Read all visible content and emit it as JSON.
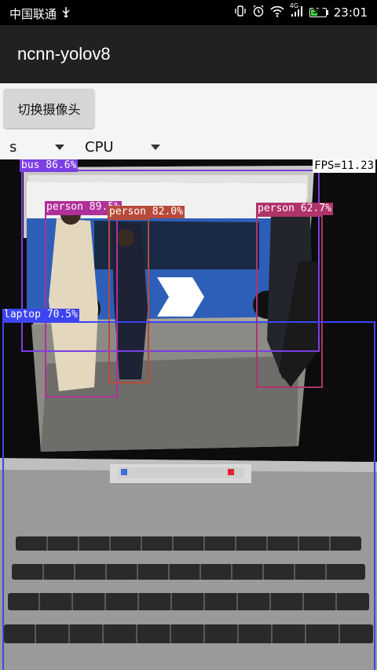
{
  "status_bar": {
    "carrier": "中国联通",
    "usb_icon": "usb-icon",
    "network_badge": "4G",
    "battery_level": "35",
    "time": "23:01"
  },
  "app_bar": {
    "title": "ncnn-yolov8"
  },
  "controls": {
    "switch_camera_label": "切换摄像头",
    "model_select": {
      "selected": "s"
    },
    "device_select": {
      "selected": "CPU"
    }
  },
  "camera_view": {
    "fps_label": "FPS=11.23",
    "detections": [
      {
        "label": "bus 86.6%",
        "color": "#7B3FE4"
      },
      {
        "label": "person 89.5%",
        "color": "#B0309A"
      },
      {
        "label": "person 82.0%",
        "color": "#B84A3A"
      },
      {
        "label": "person 62.7%",
        "color": "#B0336A"
      },
      {
        "label": "laptop 70.5%",
        "color": "#3D45F0"
      }
    ]
  }
}
